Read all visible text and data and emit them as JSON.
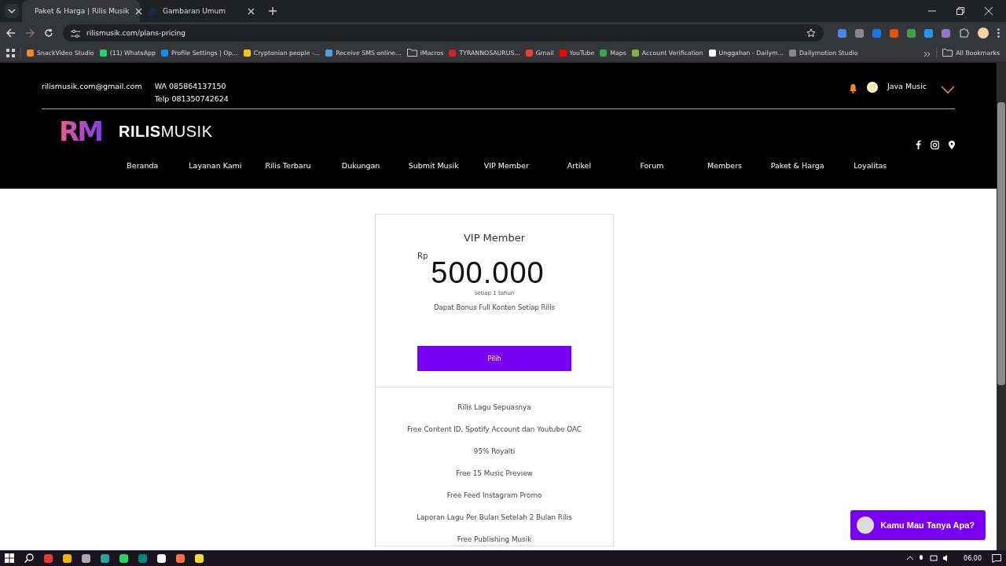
{
  "browser": {
    "tabs": [
      {
        "title": "Paket & Harga | Rilis Musik",
        "selected": true
      },
      {
        "title": "Gambaran Umum",
        "selected": false
      }
    ],
    "url": "rilismusik.com/plans-pricing",
    "bookmarks": [
      {
        "label": "SnackVideo Studio",
        "kind": "site"
      },
      {
        "label": "(11) WhatsApp",
        "kind": "site"
      },
      {
        "label": "Profile Settings | Op...",
        "kind": "site"
      },
      {
        "label": "Cryptonian people -...",
        "kind": "site"
      },
      {
        "label": "Receive SMS online...",
        "kind": "site"
      },
      {
        "label": "iMacros",
        "kind": "folder"
      },
      {
        "label": "TYRANNOSAURUS...",
        "kind": "site"
      },
      {
        "label": "Gmail",
        "kind": "site"
      },
      {
        "label": "YouTube",
        "kind": "site"
      },
      {
        "label": "Maps",
        "kind": "site"
      },
      {
        "label": "Account Verification",
        "kind": "site"
      },
      {
        "label": "Unggahan - Dailym...",
        "kind": "site"
      },
      {
        "label": "Dailymotion Studio",
        "kind": "site"
      }
    ],
    "all_bookmarks": "All Bookmarks"
  },
  "site": {
    "email": "rilismusik.com@gmail.com",
    "wa": "WA 085864137150",
    "telp": "Telp 081350742624",
    "user_name": "Java Music",
    "logo": {
      "mark": "RM",
      "bold": "RILIS",
      "light": "MUSIK"
    },
    "nav": [
      {
        "label": "Beranda"
      },
      {
        "label": "Layanan Kami"
      },
      {
        "label": "Rilis Terbaru"
      },
      {
        "label": "Dukungan"
      },
      {
        "label": "Submit Musik"
      },
      {
        "label": "VIP Member"
      },
      {
        "label": "Artikel"
      },
      {
        "label": "Forum"
      },
      {
        "label": "Members"
      },
      {
        "label": "Paket & Harga"
      },
      {
        "label": "Loyalitas"
      }
    ]
  },
  "plan": {
    "title": "VIP Member",
    "currency": "Rp",
    "price": "500.000",
    "period": "setiap 1 tahun",
    "bonus": "Dapat Bonus Full Konten Setiap Rilis",
    "button": "Pilih",
    "features": [
      "Rilis Lagu Sepuasnya",
      "Free Content ID, Spotify Account dan Youtube OAC",
      "95% Royalti",
      "Free 15 Music Preview",
      "Free Feed Instagram Promo",
      "Laporan Lagu Per Bulan Setelah 2 Bulan Rilis",
      "Free Publishing Musik"
    ]
  },
  "chat_button": "Kamu Mau Tanya Apa?",
  "taskbar": {
    "time": "06.00"
  }
}
